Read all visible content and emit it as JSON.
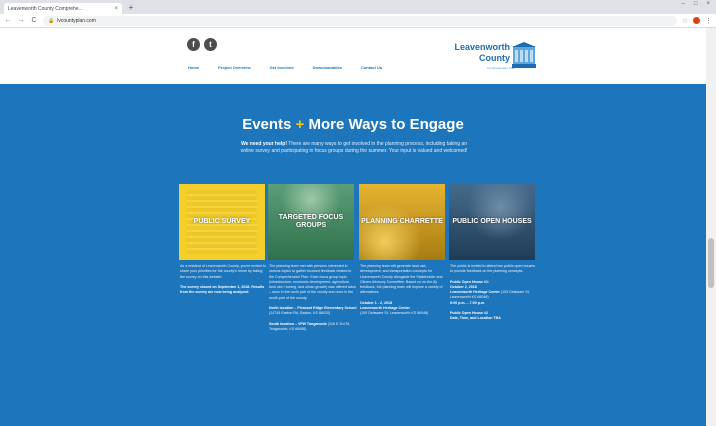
{
  "browser": {
    "tab_title": "Leavenworth County Comprehe...",
    "tab_close": "×",
    "new_tab": "+",
    "url": "lvcountyplan.com",
    "lock_icon": "🔒",
    "back": "←",
    "forward": "→",
    "reload": "C",
    "star": "☆",
    "menu": "⋮",
    "win_min": "–",
    "win_max": "□",
    "win_close": "×"
  },
  "header": {
    "social": [
      "f",
      "t"
    ],
    "nav": [
      "Home",
      "Project Overview",
      "Get Involved",
      "Downloadables",
      "Contact Us"
    ],
    "logo_line1": "Leavenworth",
    "logo_line2": "County",
    "logo_line3": "Comprehensive Plan"
  },
  "section": {
    "title_a": "Events ",
    "title_plus": "+",
    "title_b": " More Ways to Engage",
    "intro_bold": "We need your help!",
    "intro_rest": " There are many ways to get involved in the planning process, including taking an online survey and participating in focus groups during the summer. Your input is valued and welcomed!"
  },
  "cards": [
    {
      "label": "PUBLIC SURVEY"
    },
    {
      "label": "TARGETED FOCUS GROUPS"
    },
    {
      "label": "PLANNING CHARRETTE"
    },
    {
      "label": "PUBLIC OPEN HOUSES"
    }
  ],
  "columns": {
    "survey_p1": "As a resident of Leavenworth County, you're invited to share your priorities for the county's future by taking the survey on this website.",
    "survey_p2": "The survey closed on September 1, 2018. Results from the survey are now being analyzed.",
    "focus_p1": "The planning team met with persons interested in various topics to gather focused feedback related to the Comprehensive Plan. Each focus group topic (infrastructure, economic development, agriculture, land use / zoning, and urban growth) was offered twice – once in the north part of the county and once in the south part of the county.",
    "focus_north_bold": "North location – Pleasant Ridge Elementary School",
    "focus_north_rest": " (24745 Easton Rd, Easton, KS 66020)",
    "focus_south_bold": "South location – VFW Tonganoxie",
    "focus_south_rest": " (316 E 3rd St, Tonganoxie, KS 66086)",
    "charrette_p1": "The planning team will generate land use, development, and transportation concepts for Leavenworth County alongside the Stakeholder and Citizen Advisory Committee. Based on on-the-fly feedback, the planning team will explore a variety of alternatives.",
    "charrette_date": "October 1 - 2, 2018",
    "charrette_venue": "Leavenworth Heritage Center",
    "charrette_addr": "(109 Delaware St, Leavenworth KS 66048)",
    "open_p1": "The public is invited to attend two public open houses to provide feedback on the planning concepts.",
    "open_h1": "Public Open House #1:",
    "open_h1_date": "October 2, 2018",
    "open_h1_venue": "Leavenworth Heritage Center",
    "open_h1_addr": " (109 Delaware St, Leavenworth KS 66048)",
    "open_h1_time": "5:00 p.m. – 7:00 p.m.",
    "open_h2": "Public Open House #2",
    "open_h2_detail": "Date, Time, and Location TBA"
  },
  "colors": {
    "brand_blue": "#1d75bc",
    "accent_yellow": "#f4c20d"
  }
}
